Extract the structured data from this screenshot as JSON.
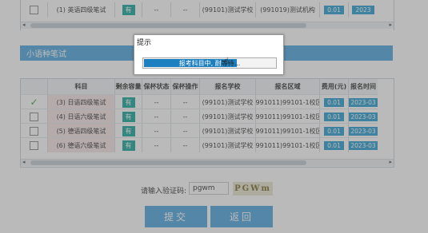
{
  "top_table": {
    "row": {
      "subject": "(1) 英语四级笔试",
      "capacity": "有",
      "status": "--",
      "op": "--",
      "school": "(99101)测试学校",
      "exam_area": "(991019)测试机构",
      "fee": "0.01",
      "time": "2023"
    }
  },
  "section": {
    "title": "小语种笔试"
  },
  "table": {
    "headers": [
      "",
      "科目",
      "剩余容量",
      "保杯状态",
      "保杯操作",
      "报名学校",
      "报名区域",
      "费用(元)",
      "报名时间"
    ],
    "rows": [
      {
        "checked": true,
        "subject": "(3) 日语四级笔试",
        "capacity": "有",
        "status": "--",
        "op": "--",
        "school": "(99101)测试学校",
        "exam_area": "(991011)99101-1校区",
        "fee": "0.01",
        "time": "2023-03"
      },
      {
        "checked": false,
        "subject": "(4) 日语六级笔试",
        "capacity": "有",
        "status": "--",
        "op": "--",
        "school": "(99101)测试学校",
        "exam_area": "(991011)99101-1校区",
        "fee": "0.01",
        "time": "2023-03"
      },
      {
        "checked": false,
        "subject": "(5) 德语四级笔试",
        "capacity": "有",
        "status": "--",
        "op": "--",
        "school": "(99101)测试学校",
        "exam_area": "(991011)99101-1校区",
        "fee": "0.01",
        "time": "2023-03"
      },
      {
        "checked": false,
        "subject": "(6) 德语六级笔试",
        "capacity": "有",
        "status": "--",
        "op": "--",
        "school": "(99101)测试学校",
        "exam_area": "(991011)99101-1校区",
        "fee": "0.01",
        "time": "2023-03"
      }
    ]
  },
  "captcha": {
    "label": "请输入验证码:",
    "value": "pgwm",
    "image_text": "PGWm"
  },
  "buttons": {
    "submit": "提交",
    "back": "返回"
  },
  "dialog": {
    "title": "提示",
    "message": "报考科目中, 耐心等待...",
    "message_head": "报考科目中, 耐",
    "message_tail": "等待...",
    "progress": 0.7
  },
  "colors": {
    "accent": "#4fa6de",
    "badge": "#19a89e",
    "pill": "#2b9fd3",
    "progress": "#1c7fbf"
  }
}
